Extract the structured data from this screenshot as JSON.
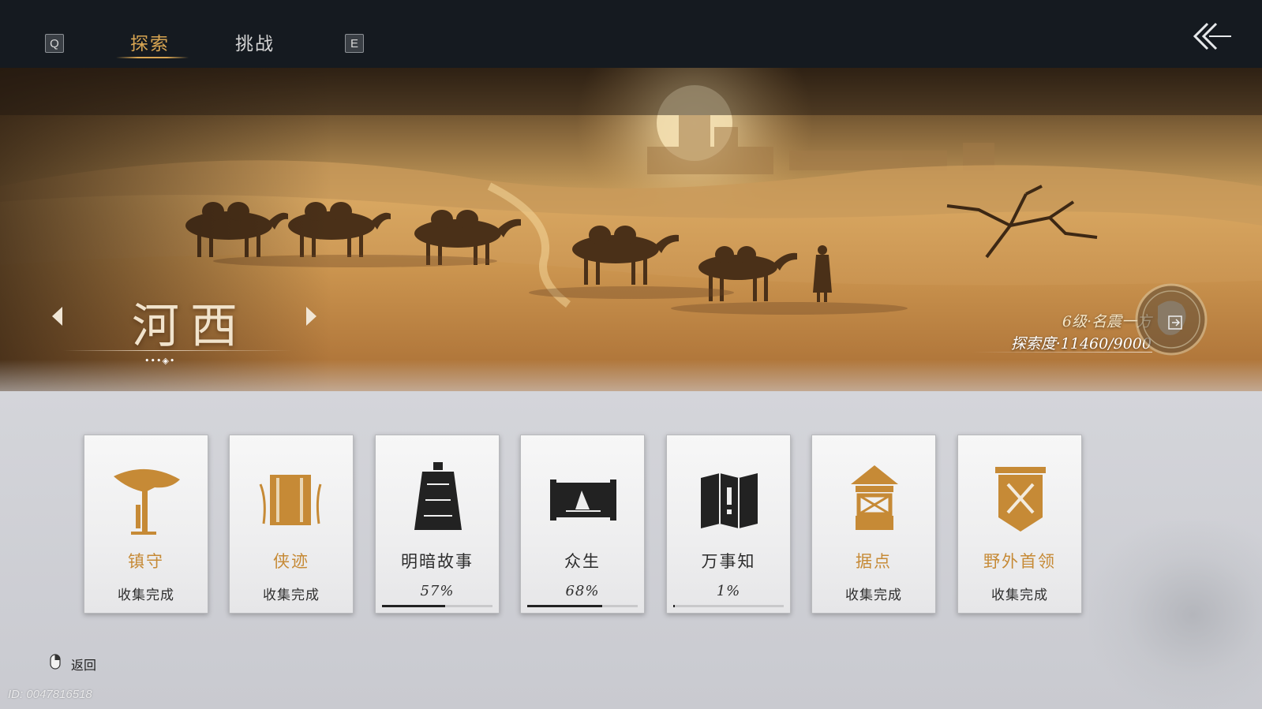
{
  "topbar": {
    "left_key": "Q",
    "right_key": "E",
    "tabs": [
      {
        "label": "探索",
        "active": true
      },
      {
        "label": "挑战",
        "active": false
      }
    ],
    "back_icon": "double-chevron-left-icon"
  },
  "banner": {
    "region_name": "河西",
    "page_dots": "•••◈•",
    "level": "6级·名震一方",
    "exploration": "探索度·11460/9000",
    "emblem_icon": "region-map-emblem-icon"
  },
  "cards": [
    {
      "title": "镇守",
      "status": "收集完成",
      "icon": "bamboo-hat-icon",
      "accent": "gold"
    },
    {
      "title": "侠迹",
      "status": "收集完成",
      "icon": "bamboo-scroll-icon",
      "accent": "gold"
    },
    {
      "title": "明暗故事",
      "status": "57%",
      "progress": 0.57,
      "icon": "bell-icon",
      "accent": "dark"
    },
    {
      "title": "众生",
      "status": "68%",
      "progress": 0.68,
      "icon": "painting-scroll-icon",
      "accent": "dark"
    },
    {
      "title": "万事知",
      "status": "1%",
      "progress": 0.01,
      "icon": "folded-map-question-icon",
      "accent": "dark"
    },
    {
      "title": "据点",
      "status": "收集完成",
      "icon": "watchtower-icon",
      "accent": "gold"
    },
    {
      "title": "野外首领",
      "status": "收集完成",
      "icon": "crossed-swords-banner-icon",
      "accent": "gold"
    }
  ],
  "footer": {
    "back_label": "返回",
    "mouse_icon": "mouse-right-click-icon",
    "uid": "ID: 0047816518"
  },
  "colors": {
    "gold": "#c68a36",
    "tab_active": "#d8a552",
    "topbar": "#151a20"
  }
}
